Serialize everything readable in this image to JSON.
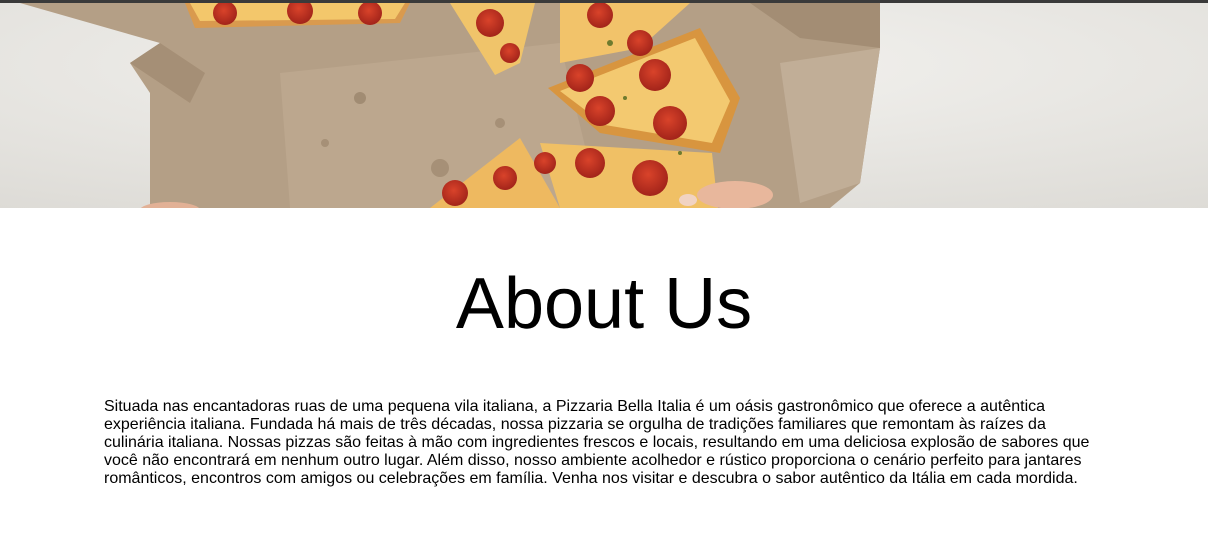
{
  "hero": {
    "image_icon": "pizza-box-photo"
  },
  "about": {
    "title": "About Us",
    "text": "Situada nas encantadoras ruas de uma pequena vila italiana, a Pizzaria Bella Italia é um oásis gastronômico que oferece a autêntica experiência italiana. Fundada há mais de três décadas, nossa pizzaria se orgulha de tradições familiares que remontam às raízes da culinária italiana. Nossas pizzas são feitas à mão com ingredientes frescos e locais, resultando em uma deliciosa explosão de sabores que você não encontrará em nenhum outro lugar. Além disso, nosso ambiente acolhedor e rústico proporciona o cenário perfeito para jantares românticos, encontros com amigos ou celebrações em família. Venha nos visitar e descubra o sabor autêntico da Itália em cada mordida."
  },
  "colors": {
    "top_bar": "#3a3a3a",
    "background": "#ffffff",
    "text": "#000000"
  }
}
